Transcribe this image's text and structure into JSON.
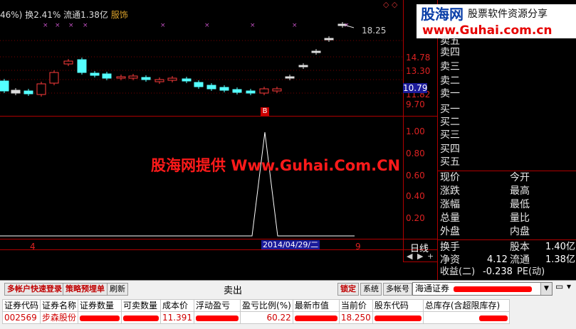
{
  "header": {
    "pct_fragment": "46%)",
    "turnover_text": "换2.41%",
    "float_text": "流通1.38亿",
    "sector": "服饰"
  },
  "price_axis": {
    "labels": [
      "18.25",
      "14.78",
      "13.30",
      "11.82",
      "10.79",
      "9.70"
    ],
    "current_price": "10.79"
  },
  "indicator_axis": {
    "labels": [
      "1.00",
      "0.80",
      "0.60",
      "0.40",
      "0.20"
    ]
  },
  "timeline": {
    "left_label": "4",
    "cursor_date": "2014/04/29/二",
    "right_label": "9",
    "period": "日线"
  },
  "signal_marker": "B",
  "watermark": {
    "logo_title": "股海网",
    "logo_sub": "股票软件资源分享",
    "logo_url": "www.Guhai.com.cn",
    "center_text": "股海网提供 Www.Guhai.Com.CN"
  },
  "order_book": {
    "sell": [
      "卖五",
      "卖四",
      "卖三",
      "卖二",
      "卖一"
    ],
    "buy": [
      "买一",
      "买二",
      "买三",
      "买四",
      "买五"
    ]
  },
  "quote": {
    "rows": [
      {
        "left": "现价",
        "right": "今开"
      },
      {
        "left": "涨跌",
        "right": "最高"
      },
      {
        "left": "涨幅",
        "right": "最低"
      },
      {
        "left": "总量",
        "right": "量比"
      },
      {
        "left": "外盘",
        "right": "内盘"
      }
    ],
    "turnover_label": "换手",
    "share_capital_label": "股本",
    "share_capital_value": "1.40亿",
    "net_assets_label": "净资",
    "net_assets_value": "4.12",
    "float_label": "流通",
    "float_value": "1.38亿",
    "earnings_label": "收益(二)",
    "earnings_value": "-0.238",
    "pe_label": "PE(动)"
  },
  "trade_panel": {
    "quick_login": "多帐户快速登录",
    "strategy_order": "策略预埋单",
    "refresh": "刷新",
    "title": "卖出",
    "lock": "锁定",
    "system": "系统",
    "multi_account": "多帐号",
    "broker_select": "海通证券",
    "columns": [
      "证券代码",
      "证券名称",
      "证券数量",
      "可卖数量",
      "成本价",
      "浮动盈亏",
      "盈亏比例(%)",
      "最新市值",
      "当前价",
      "股东代码",
      "总库存(含超限库存)"
    ],
    "rows": [
      {
        "code": "002569",
        "name": "步森股份",
        "qty": "",
        "avail": "",
        "cost": "11.391",
        "pl": "",
        "ratio": "60.22",
        "mv": "",
        "price": "18.250",
        "holder": "",
        "total": ""
      }
    ]
  }
}
